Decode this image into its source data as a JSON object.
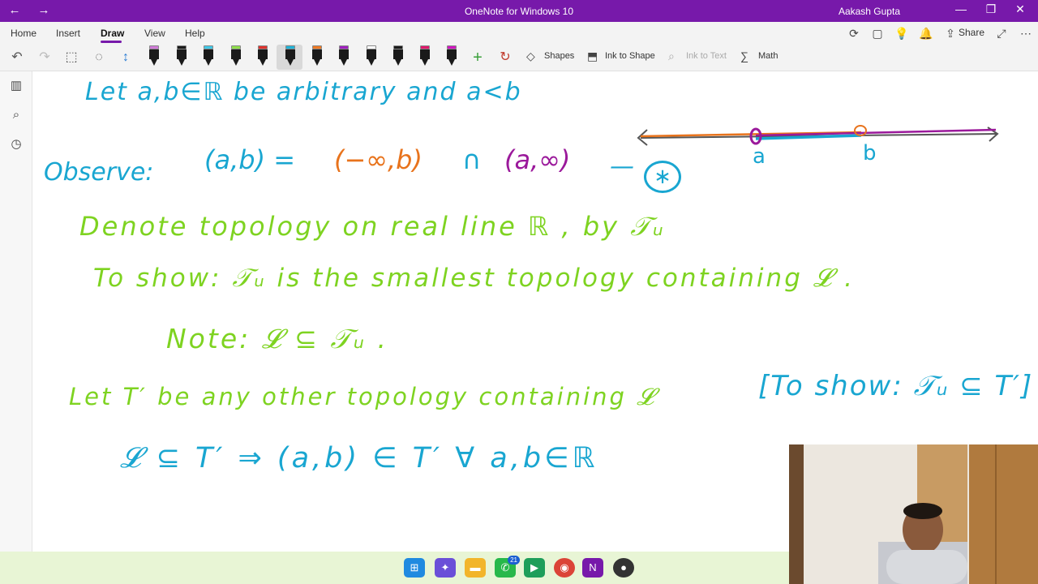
{
  "window": {
    "title": "OneNote for Windows 10",
    "user": "Aakash Gupta",
    "controls": [
      "—",
      "❐",
      "✕"
    ]
  },
  "nav": {
    "back": "←",
    "forward": "→"
  },
  "ribbon": {
    "tabs": [
      {
        "label": "Home"
      },
      {
        "label": "Insert"
      },
      {
        "label": "Draw"
      },
      {
        "label": "View"
      },
      {
        "label": "Help"
      }
    ],
    "active_tab": "Draw",
    "share_label": "Share"
  },
  "toolbar": {
    "shapes_label": "Shapes",
    "ink_to_shape_label": "Ink to Shape",
    "ink_to_text_label": "Ink to Text",
    "math_label": "Math",
    "pens": [
      {
        "band": "#d07ad8"
      },
      {
        "band": "#1a1a1a"
      },
      {
        "band": "#3fc8e8"
      },
      {
        "band": "#8fe04a"
      },
      {
        "band": "#e0322d"
      },
      {
        "band": "#1fb3d9"
      },
      {
        "band": "#f07a22"
      },
      {
        "band": "#a020c0"
      },
      {
        "band": "#ffffff"
      },
      {
        "band": "#1a1a1a"
      },
      {
        "band": "#e0186c"
      },
      {
        "band": "#d016c0"
      }
    ]
  },
  "notes": {
    "line1": "Let a,b∈ℝ be arbitrary and a<b",
    "observe_label": "Observe:",
    "observe_lhs": "(a,b) =",
    "observe_mid": "(−∞,b)",
    "observe_cap": "∩",
    "observe_right": "(a,∞)",
    "observe_tag": "—",
    "star": "∗",
    "numline_a": "a",
    "numline_b": "b",
    "denote": "Denote topology on real line ℝ , by 𝒯ᵤ",
    "toshow": "To show:  𝒯ᵤ is the smallest topology containing 𝓛 .",
    "note": "Note:  𝓛 ⊆ 𝒯ᵤ .",
    "let_t": "Let  T′ be any other topology containing 𝓛",
    "bracket": "[To show: 𝒯ᵤ ⊆ T′]",
    "implies": "𝓛 ⊆ T′  ⇒   (a,b) ∈ T′   ∀  a,b∈ℝ"
  },
  "taskbar": {
    "whatsapp_badge": "21",
    "onenote_letter": "N"
  },
  "colors": {
    "accent": "#7719aa",
    "ink_blue": "#19a6d1",
    "ink_green": "#7ed321",
    "ink_orange": "#e8731c",
    "ink_purple": "#9b199b"
  }
}
